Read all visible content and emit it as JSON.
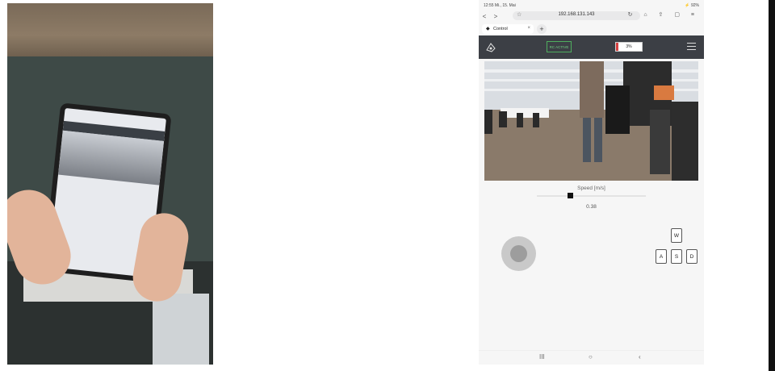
{
  "status_bar": {
    "time": "12:55 Mi., 15. Mai",
    "indicators": "⚡ 92%"
  },
  "browser": {
    "url": "192.168.131.143",
    "tab_label": "Control",
    "tab_close": "×",
    "new_tab": "+"
  },
  "app": {
    "rc_status": "RC ACTIVE",
    "battery_text": "3%",
    "battery_level": 0.1,
    "speed_label": "Speed [m/s]",
    "speed_value": "0.38",
    "speed_fraction": 0.31,
    "keys": {
      "w": "W",
      "a": "A",
      "s": "S",
      "d": "D"
    }
  },
  "android_nav": {
    "recent": "III",
    "home": "○",
    "back": "‹"
  },
  "colors": {
    "appbar": "#3c3f45",
    "rc_active": "#4fae5e",
    "battery_fill": "#d64040"
  }
}
